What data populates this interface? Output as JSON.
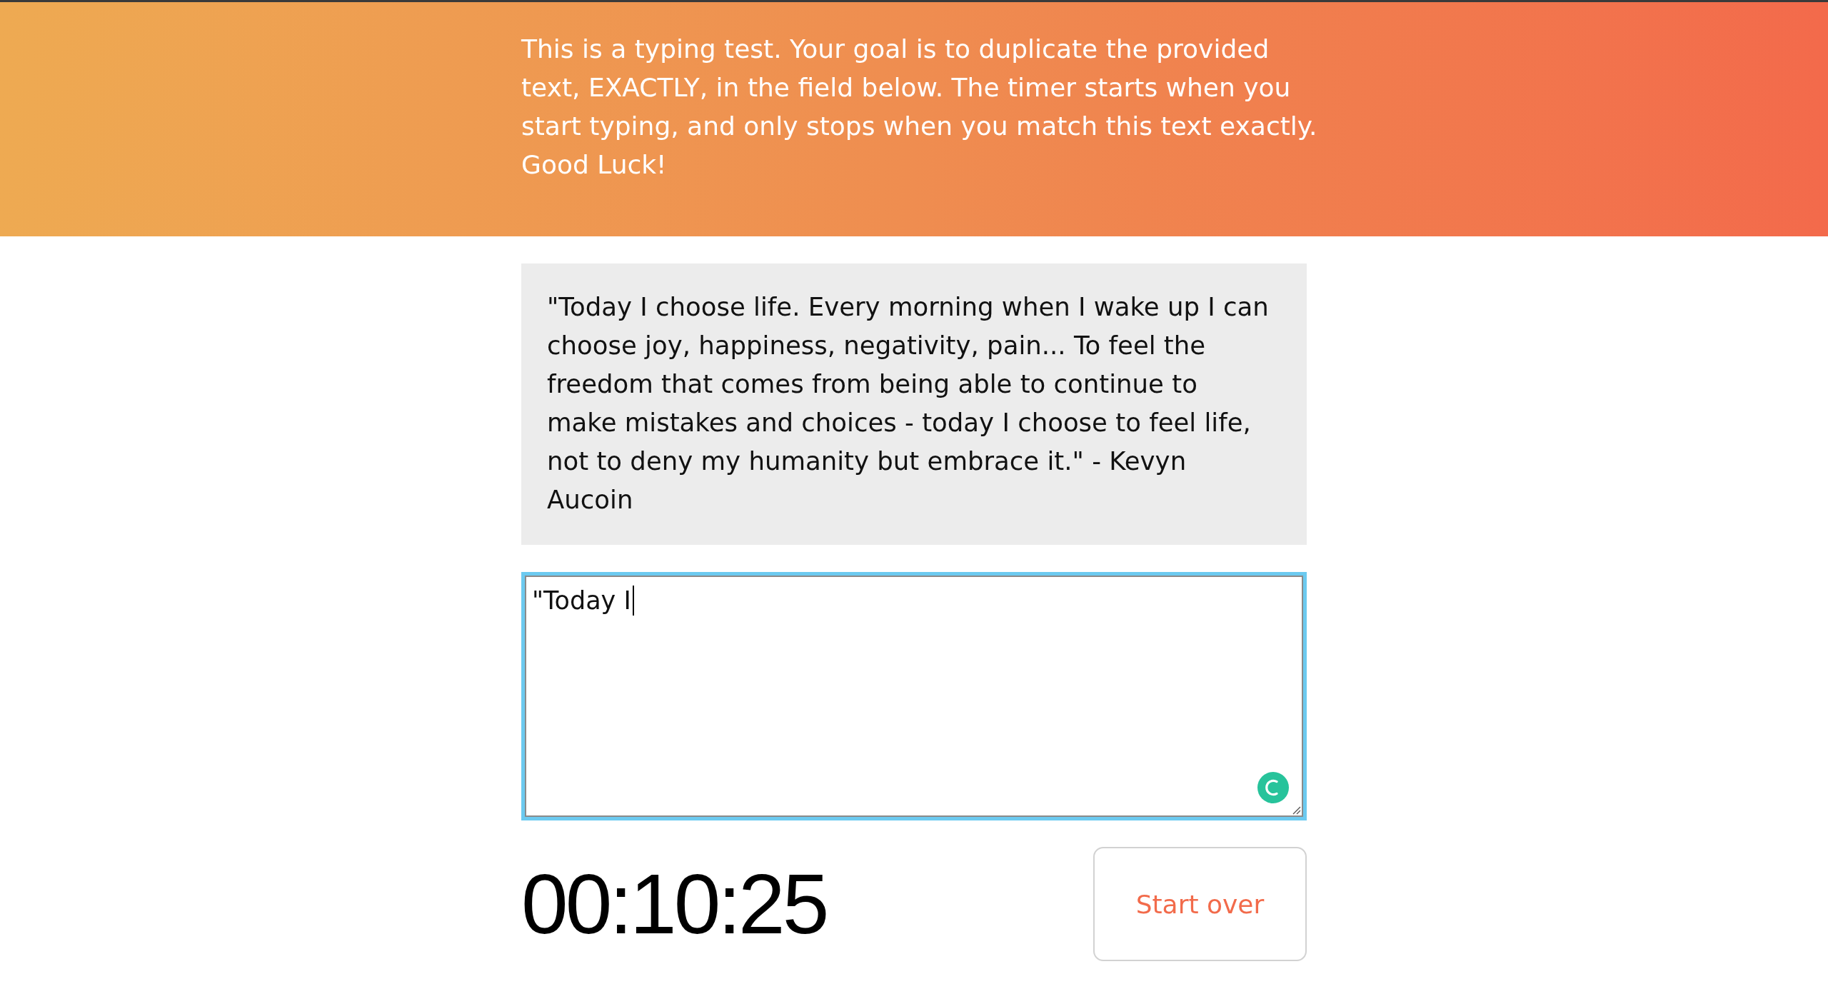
{
  "intro": {
    "text": "This is a typing test. Your goal is to duplicate the provided text, EXACTLY, in the field below. The timer starts when you start typing, and only stops when you match this text exactly. Good Luck!"
  },
  "quote": {
    "text": "\"Today I choose life. Every morning when I wake up I can choose joy, happiness, negativity, pain... To feel the freedom that comes from being able to continue to make mistakes and choices - today I choose to feel life, not to deny my humanity but embrace it.\" - Kevyn Aucoin"
  },
  "typing_field": {
    "value": "\"Today I",
    "focused": true
  },
  "timer": {
    "text": "00:10:25"
  },
  "start_over_button": {
    "label": "Start over"
  }
}
